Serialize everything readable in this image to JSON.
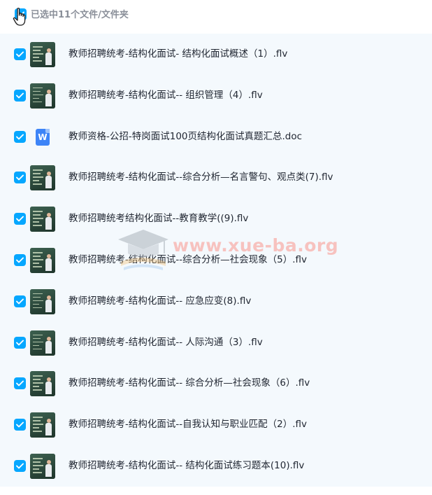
{
  "header": {
    "selection_text": "已选中11个文件/文件夹"
  },
  "colors": {
    "checkbox": "#06a7ff",
    "list_background": "#f4f9fd",
    "doc_icon": "#3d84f7"
  },
  "files": [
    {
      "name": "教师招聘统考-结构化面试- 结构化面试概述（1）.flv",
      "icon": "video-thumbnail"
    },
    {
      "name": "教师招聘统考-结构化面试-- 组织管理（4）.flv",
      "icon": "video-thumbnail"
    },
    {
      "name": "教师资格-公招-特岗面试100页结构化面试真题汇总.doc",
      "icon": "word-doc-icon",
      "icon_letter": "W"
    },
    {
      "name": "教师招聘统考-结构化面试--综合分析—名言警句、观点类(7).flv",
      "icon": "video-thumbnail"
    },
    {
      "name": "教师招聘统考结构化面试--教育教学((9).flv",
      "icon": "video-thumbnail"
    },
    {
      "name": "教师招聘统考-结构化面试--综合分析—社会现象（5）.flv",
      "icon": "video-thumbnail"
    },
    {
      "name": "教师招聘统考-结构化面试-- 应急应变(8).flv",
      "icon": "video-thumbnail"
    },
    {
      "name": "教师招聘统考-结构化面试-- 人际沟通（3）.flv",
      "icon": "video-thumbnail"
    },
    {
      "name": "教师招聘统考-结构化面试-- 综合分析—社会现象（6）.flv",
      "icon": "video-thumbnail"
    },
    {
      "name": "教师招聘统考-结构化面试--自我认知与职业匹配（2）.flv",
      "icon": "video-thumbnail"
    },
    {
      "name": "教师招聘统考-结构化面试-- 结构化面试练习题本(10).flv",
      "icon": "video-thumbnail"
    }
  ],
  "watermark": {
    "text": "www.xue-ba.org",
    "icon": "graduation-cap-icon"
  }
}
